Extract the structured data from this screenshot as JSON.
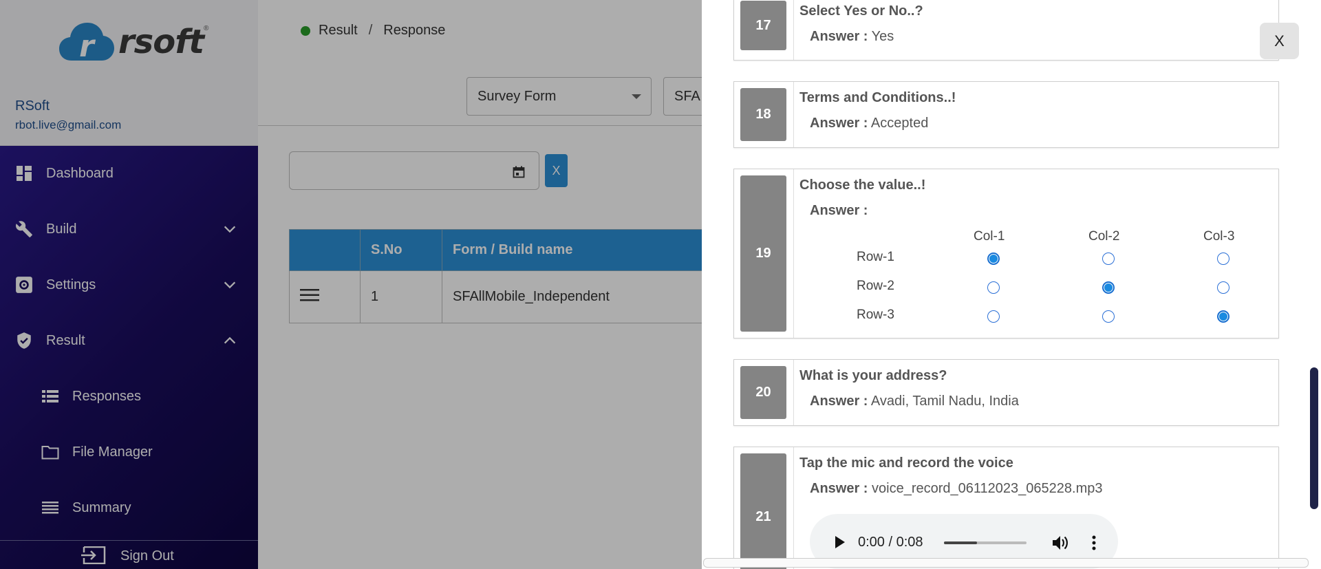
{
  "brand": {
    "logo_text": "rsoft",
    "reg_mark": "®"
  },
  "user": {
    "name": "RSoft",
    "email": "rbot.live@gmail.com"
  },
  "sidebar": {
    "items": [
      {
        "label": "Dashboard",
        "icon": "dashboard-icon"
      },
      {
        "label": "Build",
        "icon": "wrench-icon",
        "expanded": false
      },
      {
        "label": "Settings",
        "icon": "gear-icon",
        "expanded": false
      },
      {
        "label": "Result",
        "icon": "shield-check-icon",
        "expanded": true
      }
    ],
    "sub_items": [
      {
        "label": "Responses",
        "icon": "list-icon"
      },
      {
        "label": "File Manager",
        "icon": "folder-icon"
      },
      {
        "label": "Summary",
        "icon": "summary-icon"
      }
    ],
    "sign_out": "Sign Out"
  },
  "breadcrumb": {
    "first": "Result",
    "separator": "/",
    "second": "Response"
  },
  "filters": {
    "form_type": "Survey Form",
    "form_name": "SFA"
  },
  "date_filter": {
    "value": "",
    "clear_label": "X"
  },
  "table": {
    "headers": [
      "",
      "S.No",
      "Form / Build name"
    ],
    "rows": [
      {
        "sno": "1",
        "name": "SFAllMobile_Independent"
      }
    ]
  },
  "drawer": {
    "close_label": "X",
    "answer_label": "Answer :",
    "questions": [
      {
        "number": "17",
        "question": "Select Yes or No..?",
        "answer": "Yes"
      },
      {
        "number": "18",
        "question": "Terms and Conditions..!",
        "answer": "Accepted"
      },
      {
        "number": "19",
        "question": "Choose the value..!",
        "answer": "",
        "grid": {
          "columns": [
            "Col-1",
            "Col-2",
            "Col-3"
          ],
          "rows": [
            "Row-1",
            "Row-2",
            "Row-3"
          ],
          "selected": [
            0,
            1,
            2
          ]
        }
      },
      {
        "number": "20",
        "question": "What is your address?",
        "answer": "Avadi, Tamil Nadu, India"
      },
      {
        "number": "21",
        "question": "Tap the mic and record the voice",
        "answer": "voice_record_06112023_065228.mp3",
        "audio": {
          "time": "0:00 / 0:08",
          "progress": 0.4
        }
      }
    ]
  },
  "colors": {
    "nav_bg": "#1a0d5e",
    "accent": "#2b8fd6",
    "number_badge": "#848484",
    "status_dot": "#2a9d2a"
  }
}
